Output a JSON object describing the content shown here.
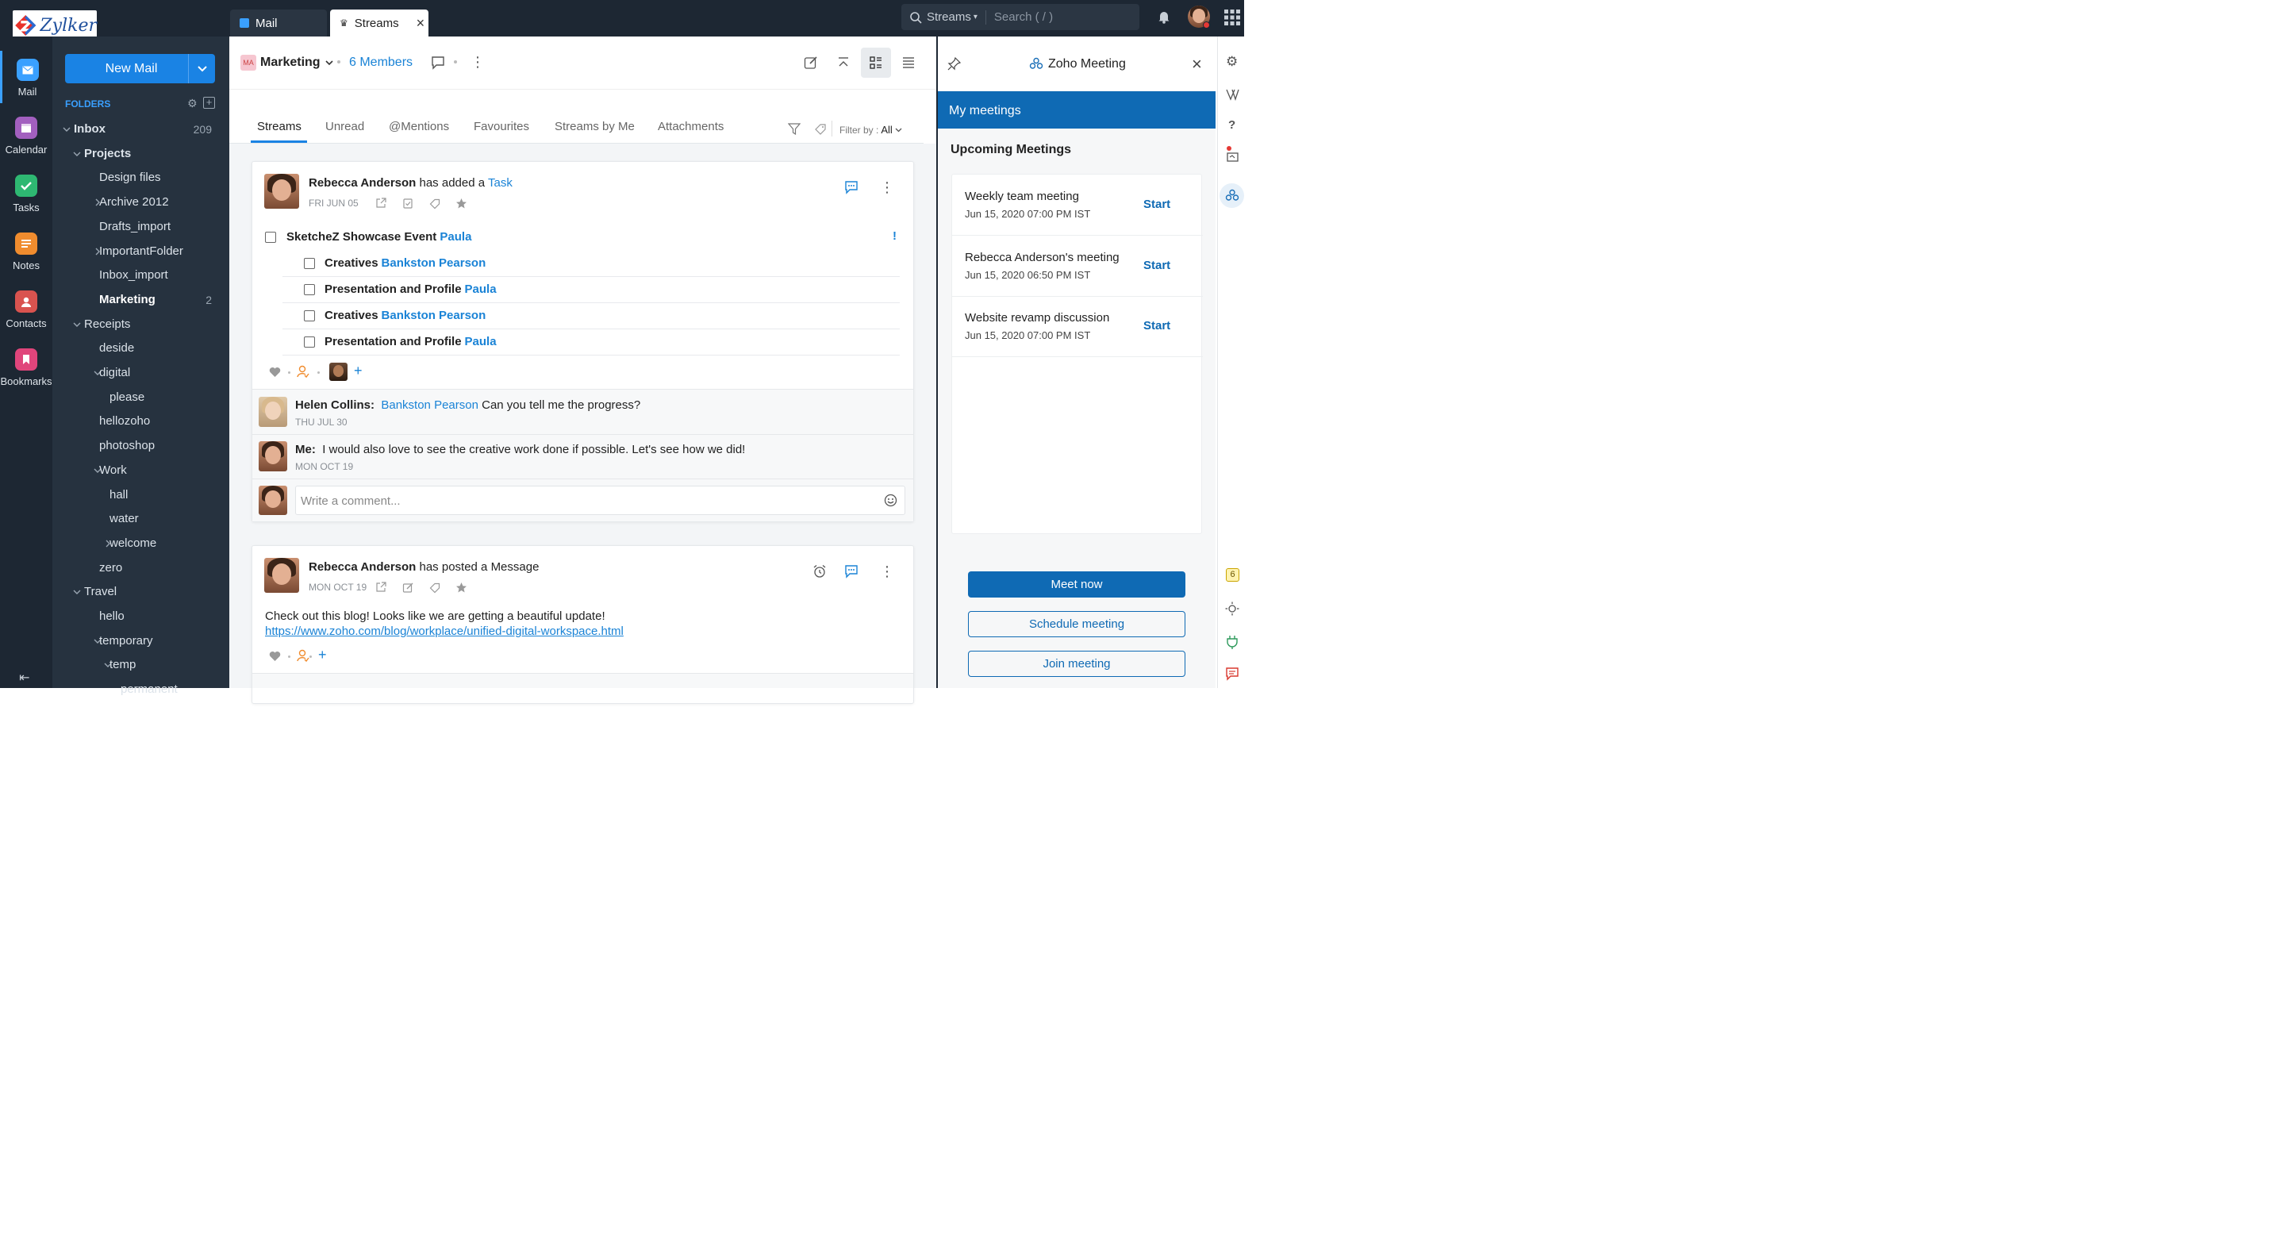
{
  "brand": {
    "logo_text": "Zylker"
  },
  "top_tabs": [
    {
      "label": "Mail"
    },
    {
      "label": "Streams"
    }
  ],
  "search": {
    "scope": "Streams",
    "placeholder": "Search ( / )"
  },
  "left_nav": [
    {
      "label": "Mail",
      "icon": "mail-icon",
      "color": "#3aa0ff"
    },
    {
      "label": "Calendar",
      "icon": "calendar-icon",
      "color": "#a25fbf"
    },
    {
      "label": "Tasks",
      "icon": "tasks-icon",
      "color": "#2eb872"
    },
    {
      "label": "Notes",
      "icon": "notes-icon",
      "color": "#f08c2e"
    },
    {
      "label": "Contacts",
      "icon": "contacts-icon",
      "color": "#d9534f"
    },
    {
      "label": "Bookmarks",
      "icon": "bookmarks-icon",
      "color": "#e0457b"
    }
  ],
  "new_mail": {
    "label": "New Mail"
  },
  "folders": {
    "heading": "FOLDERS",
    "items": [
      {
        "label": "Inbox",
        "count": "209",
        "bold": true
      },
      {
        "label": "Projects",
        "bold": true
      },
      {
        "label": "Design files"
      },
      {
        "label": "Archive 2012"
      },
      {
        "label": "Drafts_import"
      },
      {
        "label": "ImportantFolder"
      },
      {
        "label": "Inbox_import"
      },
      {
        "label": "Marketing",
        "count": "2",
        "bold": true
      },
      {
        "label": "Receipts"
      },
      {
        "label": "deside"
      },
      {
        "label": "digital"
      },
      {
        "label": "please"
      },
      {
        "label": "hellozoho"
      },
      {
        "label": "photoshop"
      },
      {
        "label": "Work"
      },
      {
        "label": "hall"
      },
      {
        "label": "water"
      },
      {
        "label": "welcome"
      },
      {
        "label": "zero"
      },
      {
        "label": "Travel"
      },
      {
        "label": "hello"
      },
      {
        "label": "temporary"
      },
      {
        "label": "temp"
      },
      {
        "label": "permanent"
      }
    ]
  },
  "group": {
    "initials": "MA",
    "name": "Marketing",
    "members": "6 Members"
  },
  "stream_tabs": [
    "Streams",
    "Unread",
    "@Mentions",
    "Favourites",
    "Streams by Me",
    "Attachments"
  ],
  "filter": {
    "label": "Filter by :",
    "value": "All"
  },
  "post1": {
    "author": "Rebecca Anderson",
    "action": "has added a",
    "type": "Task",
    "date": "FRI JUN 05",
    "task": {
      "title": "SketcheZ Showcase Event",
      "assignee": "Paula",
      "priority": "!"
    },
    "subtasks": [
      {
        "title": "Creatives",
        "assignee": "Bankston Pearson"
      },
      {
        "title": "Presentation and Profile",
        "assignee": "Paula"
      },
      {
        "title": "Creatives",
        "assignee": "Bankston Pearson"
      },
      {
        "title": "Presentation and Profile",
        "assignee": "Paula"
      }
    ],
    "comments": [
      {
        "author": "Helen Collins:",
        "mention": "Bankston Pearson",
        "text": "Can you tell me the progress?",
        "date": "THU JUL 30"
      },
      {
        "author": "Me:",
        "mention": "",
        "text": "I would also love to see the creative work done if possible. Let's see how we did!",
        "date": "MON OCT 19"
      }
    ],
    "comment_placeholder": "Write a comment..."
  },
  "post2": {
    "author": "Rebecca Anderson",
    "action": "has posted a Message",
    "date": "MON OCT 19",
    "body": "Check out this blog! Looks like we are getting a beautiful update!",
    "url": "https://www.zoho.com/blog/workplace/unified-digital-workspace.html"
  },
  "meeting_panel": {
    "title": "Zoho Meeting",
    "section": "My meetings",
    "upcoming": "Upcoming Meetings",
    "meetings": [
      {
        "title": "Weekly team meeting",
        "time": "Jun 15, 2020 07:00 PM IST",
        "action": "Start"
      },
      {
        "title": "Rebecca Anderson's meeting",
        "time": "Jun 15, 2020 06:50 PM IST",
        "action": "Start"
      },
      {
        "title": "Website revamp discussion",
        "time": "Jun 15, 2020 07:00 PM IST",
        "action": "Start"
      }
    ],
    "buttons": {
      "meet_now": "Meet now",
      "schedule": "Schedule meeting",
      "join": "Join meeting"
    }
  },
  "right_rail": {
    "badge": "6"
  },
  "colors": {
    "accent": "#1a83e4",
    "meeting_blue": "#0f6ab4",
    "link": "#1a83d6"
  }
}
